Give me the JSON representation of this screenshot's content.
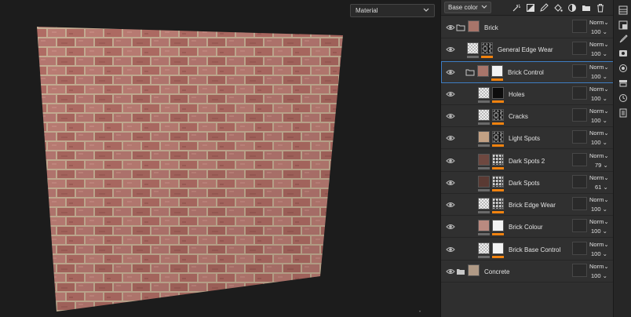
{
  "viewport": {
    "material_select": "Material"
  },
  "layers_panel": {
    "channel_select": "Base color",
    "toolbar_icons": [
      "effects-icon",
      "add-mask-icon",
      "paint-layer-icon",
      "fill-layer-icon",
      "adjustment-icon",
      "folder-icon",
      "delete-icon"
    ],
    "layers": [
      {
        "name": "Brick",
        "blend": "Norm",
        "opacity": "100",
        "kind": "folder",
        "thumbs": [
          "brick"
        ],
        "indent": 0
      },
      {
        "name": "General Edge Wear",
        "blend": "Norm",
        "opacity": "100",
        "kind": "fill",
        "thumbs": [
          "checker",
          "noise"
        ],
        "indent": 1
      },
      {
        "name": "Brick Control",
        "blend": "Norm",
        "opacity": "100",
        "kind": "folder",
        "thumbs": [
          "brick",
          "white"
        ],
        "indent": 1,
        "selected": true
      },
      {
        "name": "Holes",
        "blend": "Norm",
        "opacity": "100",
        "kind": "fill",
        "thumbs": [
          "checker",
          "black"
        ],
        "indent": 2
      },
      {
        "name": "Cracks",
        "blend": "Norm",
        "opacity": "100",
        "kind": "fill",
        "thumbs": [
          "checker",
          "noise"
        ],
        "indent": 2
      },
      {
        "name": "Light Spots",
        "blend": "Norm",
        "opacity": "100",
        "kind": "fill",
        "thumbs": [
          "tan",
          "noise"
        ],
        "indent": 2
      },
      {
        "name": "Dark Spots 2",
        "blend": "Norm",
        "opacity": "79",
        "kind": "fill",
        "thumbs": [
          "darkbrown",
          "grey-noise"
        ],
        "indent": 2
      },
      {
        "name": "Dark Spots",
        "blend": "Norm",
        "opacity": "61",
        "kind": "fill",
        "thumbs": [
          "darkerbrown",
          "grey-noise"
        ],
        "indent": 2
      },
      {
        "name": "Brick Edge Wear",
        "blend": "Norm",
        "opacity": "100",
        "kind": "fill",
        "thumbs": [
          "checker",
          "grey-noise"
        ],
        "indent": 2
      },
      {
        "name": "Brick Colour",
        "blend": "Norm",
        "opacity": "100",
        "kind": "fill",
        "thumbs": [
          "pinkbrown",
          "white"
        ],
        "indent": 2
      },
      {
        "name": "Brick Base Control",
        "blend": "Norm",
        "opacity": "100",
        "kind": "fill",
        "thumbs": [
          "checker",
          "white"
        ],
        "indent": 2
      },
      {
        "name": "Concrete",
        "blend": "Norm",
        "opacity": "100",
        "kind": "folder",
        "thumbs": [
          "concrete"
        ],
        "indent": 0
      }
    ]
  },
  "rail_icons": [
    "layers-icon",
    "brush-icon",
    "properties-icon",
    "display-icon",
    "shelf-icon",
    "history-icon",
    "log-icon"
  ],
  "colors": {
    "accent_orange": "#f0820f",
    "selection_blue": "#3d7cc2",
    "brick": "#b07068",
    "mortar": "#c9b29a"
  }
}
